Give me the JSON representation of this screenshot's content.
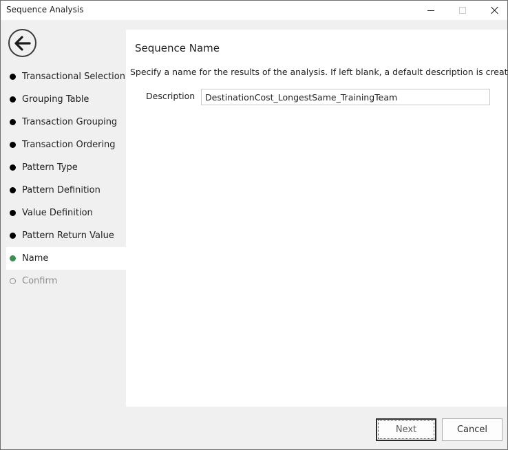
{
  "window": {
    "title": "Sequence Analysis"
  },
  "nav": {
    "items": [
      {
        "label": "Transactional Selection",
        "state": "done"
      },
      {
        "label": "Grouping Table",
        "state": "done"
      },
      {
        "label": "Transaction Grouping",
        "state": "done"
      },
      {
        "label": "Transaction Ordering",
        "state": "done"
      },
      {
        "label": "Pattern Type",
        "state": "done"
      },
      {
        "label": "Pattern Definition",
        "state": "done"
      },
      {
        "label": "Value Definition",
        "state": "done"
      },
      {
        "label": "Pattern Return Value",
        "state": "done"
      },
      {
        "label": "Name",
        "state": "active"
      },
      {
        "label": "Confirm",
        "state": "pending"
      }
    ]
  },
  "main": {
    "title": "Sequence Name",
    "instruction": "Specify a name for the results of the analysis. If left blank, a default description is created.",
    "description_label": "Description",
    "description_value": "DestinationCost_LongestSame_TrainingTeam"
  },
  "footer": {
    "next_label": "Next",
    "cancel_label": "Cancel"
  },
  "colors": {
    "active_dot": "#3e8e54",
    "done_dot": "#000000",
    "pending_dot": "#8c8c8c"
  }
}
